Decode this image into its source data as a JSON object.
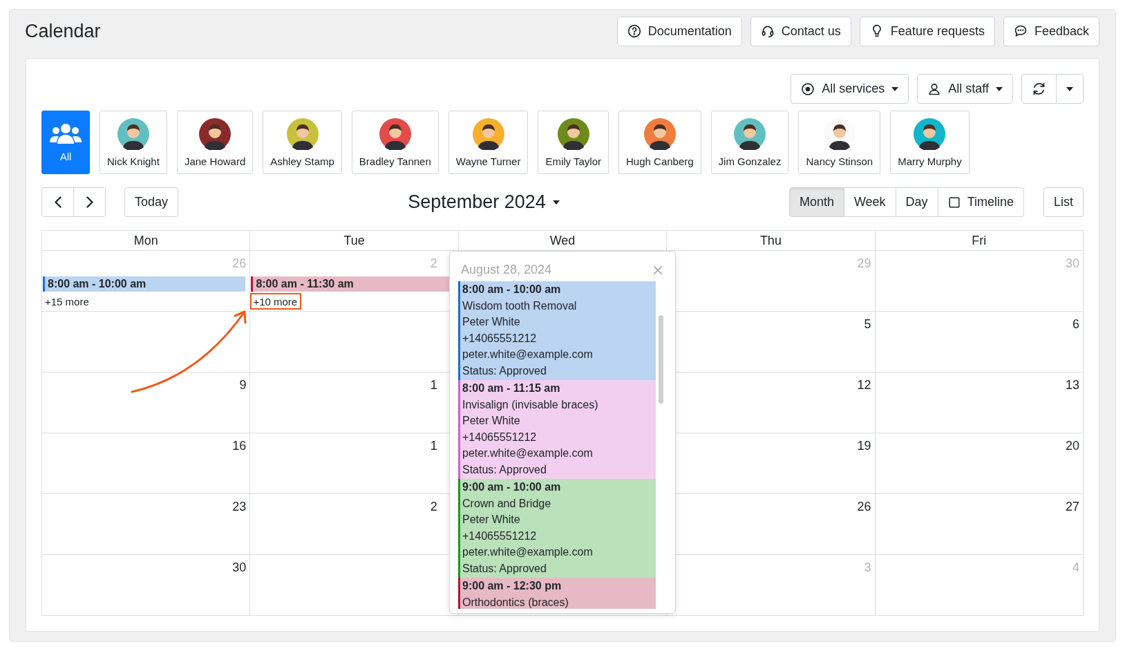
{
  "title": "Calendar",
  "header_buttons": [
    {
      "label": "Documentation",
      "kind": "help"
    },
    {
      "label": "Contact us",
      "kind": "support"
    },
    {
      "label": "Feature requests",
      "kind": "idea"
    },
    {
      "label": "Feedback",
      "kind": "chat"
    }
  ],
  "filters": {
    "services": "All services",
    "staff": "All staff"
  },
  "staff": [
    {
      "name": "All",
      "kind": "all",
      "selected": true
    },
    {
      "name": "Nick Knight",
      "kind": "person",
      "selected": false,
      "color": "#62bfc0"
    },
    {
      "name": "Jane Howard",
      "kind": "person",
      "selected": false,
      "color": "#8b2a2a"
    },
    {
      "name": "Ashley Stamp",
      "kind": "person",
      "selected": false,
      "color": "#c8c23a"
    },
    {
      "name": "Bradley Tannen",
      "kind": "person",
      "selected": false,
      "color": "#e44b4b"
    },
    {
      "name": "Wayne Turner",
      "kind": "person",
      "selected": false,
      "color": "#f6b02e"
    },
    {
      "name": "Emily Taylor",
      "kind": "person",
      "selected": false,
      "color": "#6f8a1a"
    },
    {
      "name": "Hugh Canberg",
      "kind": "person",
      "selected": false,
      "color": "#f07c3e"
    },
    {
      "name": "Jim Gonzalez",
      "kind": "person",
      "selected": false,
      "color": "#62bfc0"
    },
    {
      "name": "Nancy Stinson",
      "kind": "person",
      "selected": false,
      "color": "#fafafa"
    },
    {
      "name": "Marry Murphy",
      "kind": "person",
      "selected": false,
      "color": "#12b5c9"
    }
  ],
  "nav": {
    "today": "Today",
    "period": "September 2024",
    "views": [
      {
        "label": "Month",
        "selected": true
      },
      {
        "label": "Week",
        "selected": false
      },
      {
        "label": "Day",
        "selected": false
      }
    ],
    "timeline": {
      "label": "Timeline",
      "checked": false
    },
    "list": "List"
  },
  "calendar": {
    "weekdays": [
      "Mon",
      "Tue",
      "Wed",
      "Thu",
      "Fri"
    ],
    "weeks": [
      {
        "mon": {
          "date": "26",
          "other_month": true,
          "events": [
            {
              "time": "8:00 am - 10:00 am",
              "color": "#1b6fd0"
            }
          ],
          "more": {
            "label": "+15 more",
            "highlighted": false
          }
        },
        "tue": {
          "date": "2",
          "other_month": true,
          "events": [
            {
              "time": "8:00 am - 11:30 am",
              "color": "#b0143c"
            }
          ],
          "more": {
            "label": "+10 more",
            "highlighted": true
          }
        },
        "thu": {
          "date": "29",
          "other_month": true
        },
        "fri": {
          "date": "30",
          "other_month": true
        }
      },
      {
        "thu": {
          "date": "5",
          "other_month": false
        },
        "fri": {
          "date": "6",
          "other_month": false
        }
      },
      {
        "mon": {
          "date": "9",
          "other_month": false
        },
        "tue": {
          "date": "1",
          "other_month": false
        },
        "thu": {
          "date": "12",
          "other_month": false
        },
        "fri": {
          "date": "13",
          "other_month": false
        }
      },
      {
        "mon": {
          "date": "16",
          "other_month": false
        },
        "tue": {
          "date": "1",
          "other_month": false
        },
        "thu": {
          "date": "19",
          "other_month": false
        },
        "fri": {
          "date": "20",
          "other_month": false
        }
      },
      {
        "mon": {
          "date": "23",
          "other_month": false
        },
        "tue": {
          "date": "2",
          "other_month": false
        },
        "thu": {
          "date": "26",
          "other_month": false
        },
        "fri": {
          "date": "27",
          "other_month": false
        }
      },
      {
        "mon": {
          "date": "30",
          "other_month": false
        },
        "thu": {
          "date": "3",
          "other_month": true
        },
        "fri": {
          "date": "4",
          "other_month": true
        }
      }
    ],
    "popup": {
      "title": "August 28, 2024",
      "events": [
        {
          "time": "8:00 am - 10:00 am",
          "color": "#1b6fd0",
          "lines": [
            "Wisdom tooth Removal",
            "Peter White",
            "+14065551212",
            "peter.white@example.com",
            "Status: Approved"
          ]
        },
        {
          "time": "8:00 am - 11:15 am",
          "color": "#d25fd0",
          "lines": [
            "Invisalign (invisable braces)",
            "Peter White",
            "+14065551212",
            "peter.white@example.com",
            "Status: Approved"
          ]
        },
        {
          "time": "9:00 am - 10:00 am",
          "color": "#1a9a1a",
          "lines": [
            "Crown and Bridge",
            "Peter White",
            "+14065551212",
            "peter.white@example.com",
            "Status: Approved"
          ]
        },
        {
          "time": "9:00 am - 12:30 pm",
          "color": "#b0143c",
          "lines": [
            "Orthodontics (braces)"
          ]
        }
      ]
    }
  }
}
